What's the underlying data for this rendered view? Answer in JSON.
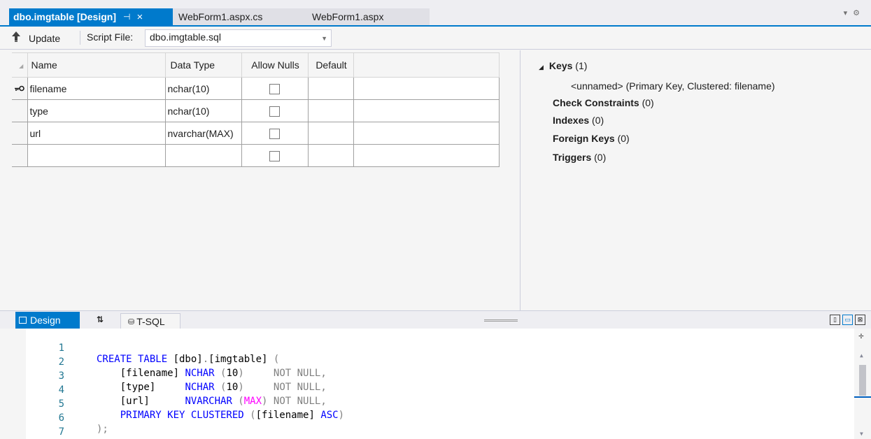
{
  "tabs": [
    {
      "label": "dbo.imgtable [Design]",
      "active": true,
      "pin": "⊣",
      "close": "×"
    },
    {
      "label": "WebForm1.aspx.cs",
      "active": false
    },
    {
      "label": "WebForm1.aspx",
      "active": false
    }
  ],
  "strip_icons": {
    "dropdown": "▾",
    "settings": "⚙"
  },
  "toolbar": {
    "update_label": "Update",
    "script_label": "Script File:",
    "script_file": "dbo.imgtable.sql"
  },
  "grid": {
    "headers": [
      "Name",
      "Data Type",
      "Allow Nulls",
      "Default"
    ],
    "rows": [
      {
        "name": "filename",
        "type": "nchar(10)",
        "allow_nulls": false,
        "default": "",
        "primary_key": true
      },
      {
        "name": "type",
        "type": "nchar(10)",
        "allow_nulls": false,
        "default": "",
        "primary_key": false
      },
      {
        "name": "url",
        "type": "nvarchar(MAX)",
        "allow_nulls": false,
        "default": "",
        "primary_key": false
      },
      {
        "name": "",
        "type": "",
        "allow_nulls": false,
        "default": "",
        "primary_key": false
      }
    ]
  },
  "properties": {
    "keys_label": "Keys",
    "keys_count": "(1)",
    "key_entry": "<unnamed>   (Primary Key, Clustered: filename)",
    "check_label": "Check Constraints",
    "check_count": "(0)",
    "indexes_label": "Indexes",
    "indexes_count": "(0)",
    "fk_label": "Foreign Keys",
    "fk_count": "(0)",
    "triggers_label": "Triggers",
    "triggers_count": "(0)"
  },
  "bottom_tabs": {
    "design": "Design",
    "swap": "⇅",
    "tsql": "T-SQL"
  },
  "code": {
    "line_numbers": [
      "1",
      "2",
      "3",
      "4",
      "5",
      "6",
      "7"
    ]
  },
  "colors": {
    "accent": "#007acc",
    "keyword": "#0000ff",
    "grey": "#808080",
    "magenta": "#ff00ff",
    "line_number": "#237893"
  }
}
